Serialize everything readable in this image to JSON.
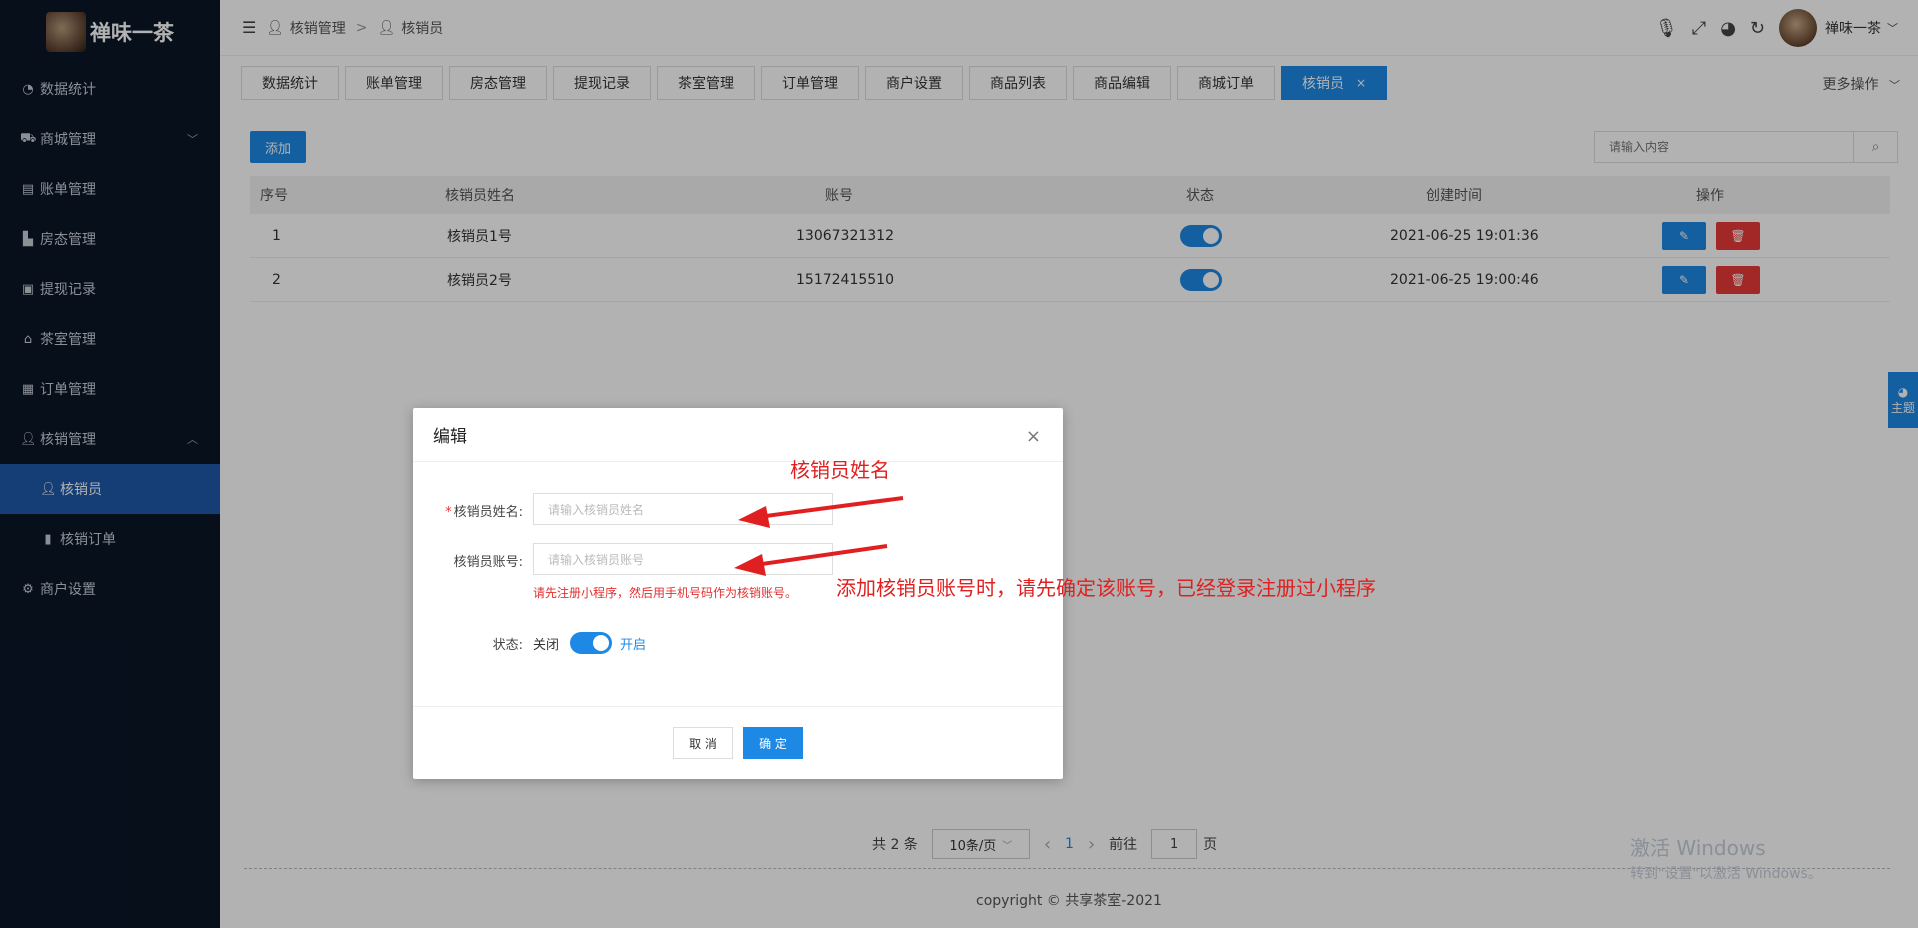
{
  "brand": {
    "name": "禅味一茶"
  },
  "sidebar": {
    "items": [
      {
        "label": "数据统计",
        "icon": "dashboard-icon"
      },
      {
        "label": "商城管理",
        "icon": "shop-icon"
      },
      {
        "label": "账单管理",
        "icon": "bill-icon"
      },
      {
        "label": "房态管理",
        "icon": "chart-icon"
      },
      {
        "label": "提现记录",
        "icon": "money-icon"
      },
      {
        "label": "茶室管理",
        "icon": "home-icon"
      },
      {
        "label": "订单管理",
        "icon": "order-icon"
      },
      {
        "label": "核销管理",
        "icon": "user-icon"
      },
      {
        "label": "核销员",
        "icon": "user-icon"
      },
      {
        "label": "核销订单",
        "icon": "trash-icon"
      },
      {
        "label": "商户设置",
        "icon": "gear-icon"
      }
    ]
  },
  "header": {
    "breadcrumb": [
      "核销管理",
      ">",
      "核销员"
    ],
    "username": "禅味一茶"
  },
  "tabs": [
    "数据统计",
    "账单管理",
    "房态管理",
    "提现记录",
    "茶室管理",
    "订单管理",
    "商户设置",
    "商品列表",
    "商品编辑",
    "商城订单",
    "核销员"
  ],
  "tab_close": "×",
  "more_ops": "更多操作",
  "toolbar": {
    "add_label": "添加",
    "search_placeholder": "请输入内容"
  },
  "table": {
    "headers": [
      "序号",
      "核销员姓名",
      "账号",
      "状态",
      "创建时间",
      "操作"
    ],
    "rows": [
      {
        "no": "1",
        "name": "核销员1号",
        "account": "13067321312",
        "status": true,
        "created": "2021-06-25 19:01:36"
      },
      {
        "no": "2",
        "name": "核销员2号",
        "account": "15172415510",
        "status": true,
        "created": "2021-06-25 19:00:46"
      }
    ]
  },
  "pagination": {
    "total": "共 2 条",
    "page_size": "10条/页",
    "prev": "‹",
    "current": "1",
    "next": "›",
    "goto_prefix": "前往",
    "goto_value": "1",
    "goto_suffix": "页"
  },
  "copyright": "copyright © 共享茶室-2021",
  "watermark": {
    "line1": "激活 Windows",
    "line2": "转到\"设置\"以激活 Windows。"
  },
  "theme_tab": "主题",
  "modal": {
    "title": "编辑",
    "close": "×",
    "name_label": "核销员姓名:",
    "name_placeholder": "请输入核销员姓名",
    "account_label": "核销员账号:",
    "account_placeholder": "请输入核销员账号",
    "hint": "请先注册小程序，然后用手机号码作为核销账号。",
    "status_label": "状态:",
    "status_off": "关闭",
    "status_on": "开启",
    "status_value": true,
    "cancel": "取 消",
    "confirm": "确 定"
  },
  "annotations": {
    "name_note": "核销员姓名",
    "account_note": "添加核销员账号时，请先确定该账号，已经登录注册过小程序"
  },
  "colors": {
    "accent": "#1e88e5",
    "danger": "#e83a3a",
    "sidebar_bg": "#0b1628",
    "annotation": "#e02020"
  }
}
